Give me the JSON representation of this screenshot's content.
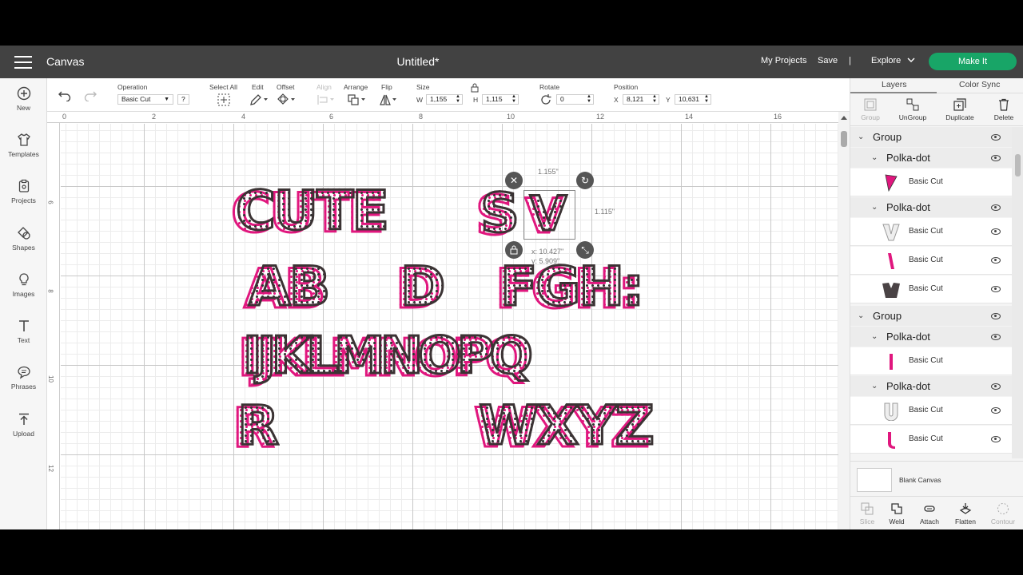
{
  "header": {
    "app_name": "Canvas",
    "doc_title": "Untitled*",
    "my_projects": "My Projects",
    "save": "Save",
    "separator": "|",
    "explore": "Explore",
    "make_it": "Make It",
    "accent_color": "#18a567"
  },
  "left_nav": [
    {
      "label": "New",
      "icon": "plus-circle-icon"
    },
    {
      "label": "Templates",
      "icon": "shirt-icon"
    },
    {
      "label": "Projects",
      "icon": "clipboard-icon"
    },
    {
      "label": "Shapes",
      "icon": "shapes-icon"
    },
    {
      "label": "Images",
      "icon": "lightbulb-icon"
    },
    {
      "label": "Text",
      "icon": "text-icon"
    },
    {
      "label": "Phrases",
      "icon": "speech-bubble-icon"
    },
    {
      "label": "Upload",
      "icon": "upload-icon"
    }
  ],
  "toolbar": {
    "operation_label": "Operation",
    "operation_value": "Basic Cut",
    "help": "?",
    "select_all": "Select All",
    "edit": "Edit",
    "offset": "Offset",
    "align": "Align",
    "arrange": "Arrange",
    "flip": "Flip",
    "size_label": "Size",
    "w_label": "W",
    "w_value": "1,155",
    "h_label": "H",
    "h_value": "1,115",
    "rotate_label": "Rotate",
    "rotate_value": "0",
    "position_label": "Position",
    "x_label": "X",
    "x_value": "8,121",
    "y_label": "Y",
    "y_value": "10,631"
  },
  "rulers": {
    "top": [
      "0",
      "2",
      "4",
      "6",
      "8",
      "10",
      "12",
      "14",
      "16"
    ],
    "left": [
      "6",
      "8",
      "10",
      "12"
    ]
  },
  "canvas": {
    "pink": "#e0177e",
    "outline": "#3b3334",
    "lines": [
      "CUTE",
      "S",
      "V",
      "AB",
      "D",
      "FGH:",
      "IJKLMNOPQ",
      "R",
      "WXYZ"
    ],
    "selection": {
      "width_label": "1.155\"",
      "height_label": "1.115\"",
      "pos_x": "x: 10.427\"",
      "pos_y": "y: 5.909\""
    }
  },
  "right_panel": {
    "tabs": [
      "Layers",
      "Color Sync"
    ],
    "actions": [
      {
        "label": "Group",
        "icon": "group-icon",
        "enabled": false
      },
      {
        "label": "UnGroup",
        "icon": "ungroup-icon",
        "enabled": true
      },
      {
        "label": "Duplicate",
        "icon": "duplicate-icon",
        "enabled": true
      },
      {
        "label": "Delete",
        "icon": "trash-icon",
        "enabled": true
      }
    ],
    "layers": [
      {
        "type": "group",
        "name": "Group"
      },
      {
        "type": "sub",
        "name": "Polka-dot"
      },
      {
        "type": "leaf",
        "name": "Basic Cut"
      },
      {
        "type": "sub",
        "name": "Polka-dot"
      },
      {
        "type": "leaf",
        "name": "Basic Cut"
      },
      {
        "type": "leaf",
        "name": "Basic Cut"
      },
      {
        "type": "leaf",
        "name": "Basic Cut"
      },
      {
        "type": "group",
        "name": "Group"
      },
      {
        "type": "sub",
        "name": "Polka-dot"
      },
      {
        "type": "leaf",
        "name": "Basic Cut"
      },
      {
        "type": "sub",
        "name": "Polka-dot"
      },
      {
        "type": "leaf",
        "name": "Basic Cut"
      },
      {
        "type": "leaf",
        "name": "Basic Cut"
      }
    ],
    "blank_canvas": "Blank Canvas",
    "bottom_actions": [
      {
        "label": "Slice",
        "icon": "slice-icon",
        "enabled": false
      },
      {
        "label": "Weld",
        "icon": "weld-icon",
        "enabled": true
      },
      {
        "label": "Attach",
        "icon": "attach-icon",
        "enabled": true
      },
      {
        "label": "Flatten",
        "icon": "flatten-icon",
        "enabled": true
      },
      {
        "label": "Contour",
        "icon": "contour-icon",
        "enabled": false
      }
    ]
  }
}
